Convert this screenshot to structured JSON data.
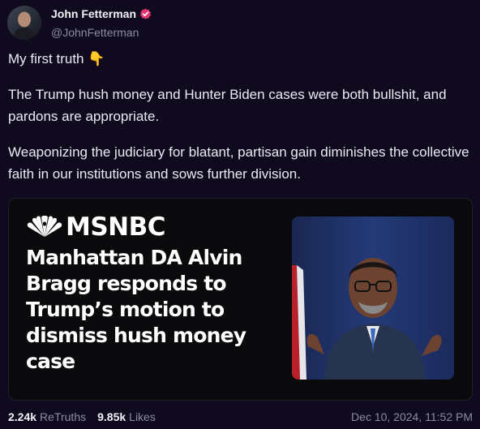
{
  "author": {
    "display_name": "John Fetterman",
    "handle": "@JohnFetterman",
    "verified_badge_icon": "verified-badge-icon",
    "badge_color": "#e0356f"
  },
  "post": {
    "paragraphs": [
      "My first truth 👇",
      "The Trump hush money and Hunter Biden cases were both bullshit, and pardons are appropriate.",
      "Weaponizing the judiciary for blatant, partisan gain diminishes the collective faith in our institutions and sows further division."
    ]
  },
  "link_card": {
    "brand": "MSNBC",
    "headline": "Manhattan DA Alvin Bragg responds to Trump’s motion to dismiss hush money case"
  },
  "stats": {
    "retruths_count": "2.24k",
    "retruths_label": "ReTruths",
    "likes_count": "9.85k",
    "likes_label": "Likes",
    "timestamp": "Dec 10, 2024, 11:52 PM"
  }
}
